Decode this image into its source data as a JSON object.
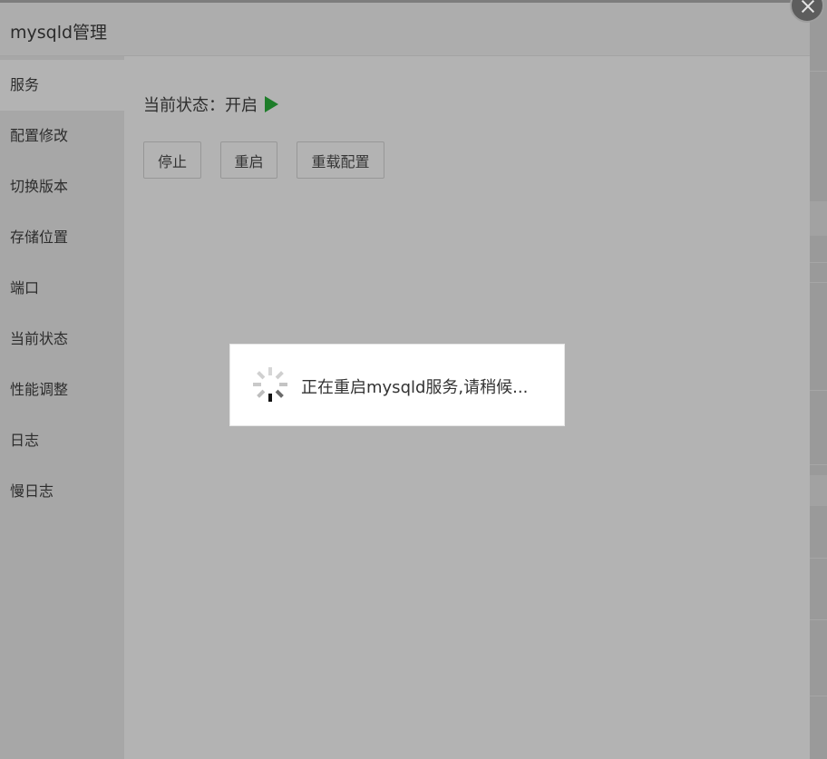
{
  "dialog": {
    "title": "mysqld管理"
  },
  "sidebar": {
    "items": [
      {
        "label": "服务",
        "active": true
      },
      {
        "label": "配置修改",
        "active": false
      },
      {
        "label": "切换版本",
        "active": false
      },
      {
        "label": "存储位置",
        "active": false
      },
      {
        "label": "端口",
        "active": false
      },
      {
        "label": "当前状态",
        "active": false
      },
      {
        "label": "性能调整",
        "active": false
      },
      {
        "label": "日志",
        "active": false
      },
      {
        "label": "慢日志",
        "active": false
      }
    ]
  },
  "service": {
    "status_label": "当前状态：开启",
    "status_color": "#1e7d2a",
    "buttons": {
      "stop": "停止",
      "restart": "重启",
      "reload": "重载配置"
    }
  },
  "loading": {
    "message": "正在重启mysqld服务,请稍候..."
  },
  "icons": {
    "close": "close-icon",
    "status": "play-icon",
    "loading": "spinner-icon"
  }
}
